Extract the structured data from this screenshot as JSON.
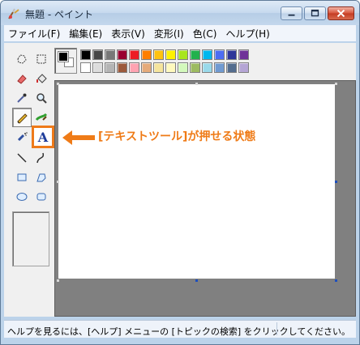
{
  "window": {
    "title": "無題 - ペイント"
  },
  "menu": [
    "ファイル(F)",
    "編集(E)",
    "表示(V)",
    "変形(I)",
    "色(C)",
    "ヘルプ(H)"
  ],
  "tools": {
    "free_select": "free-form-select",
    "select": "select",
    "eraser": "eraser",
    "fill": "fill-with-color",
    "picker": "pick-color",
    "magnifier": "magnifier",
    "pencil": "pencil",
    "brush": "brush",
    "airbrush": "airbrush",
    "text": "text",
    "line": "line",
    "curve": "curve",
    "rectangle": "rectangle",
    "polygon": "polygon",
    "ellipse": "ellipse",
    "rounded_rectangle": "rounded-rectangle",
    "text_tool_label": "A"
  },
  "palette": {
    "foreground": "#000000",
    "background": "#ffffff",
    "row1": [
      "#000000",
      "#464646",
      "#787878",
      "#990030",
      "#ed1c24",
      "#ff7e00",
      "#ffc20e",
      "#fff200",
      "#a8e61d",
      "#22b14c",
      "#00b7ef",
      "#4d6df3",
      "#2f3699",
      "#6f3198"
    ],
    "row2": [
      "#ffffff",
      "#dcdcdc",
      "#b4b4b4",
      "#9c5a3c",
      "#ffa3b1",
      "#e5aa7a",
      "#f5e49c",
      "#fff9bd",
      "#d3f9bc",
      "#9dbb61",
      "#99d9ea",
      "#709ad1",
      "#546d8e",
      "#b5a5d5"
    ]
  },
  "annotation": {
    "text": "[テキストツール]が押せる状態",
    "color": "#ef7b17"
  },
  "status": {
    "text": "ヘルプを見るには、[ヘルプ] メニューの [トピックの検索] をクリックしてください。"
  }
}
